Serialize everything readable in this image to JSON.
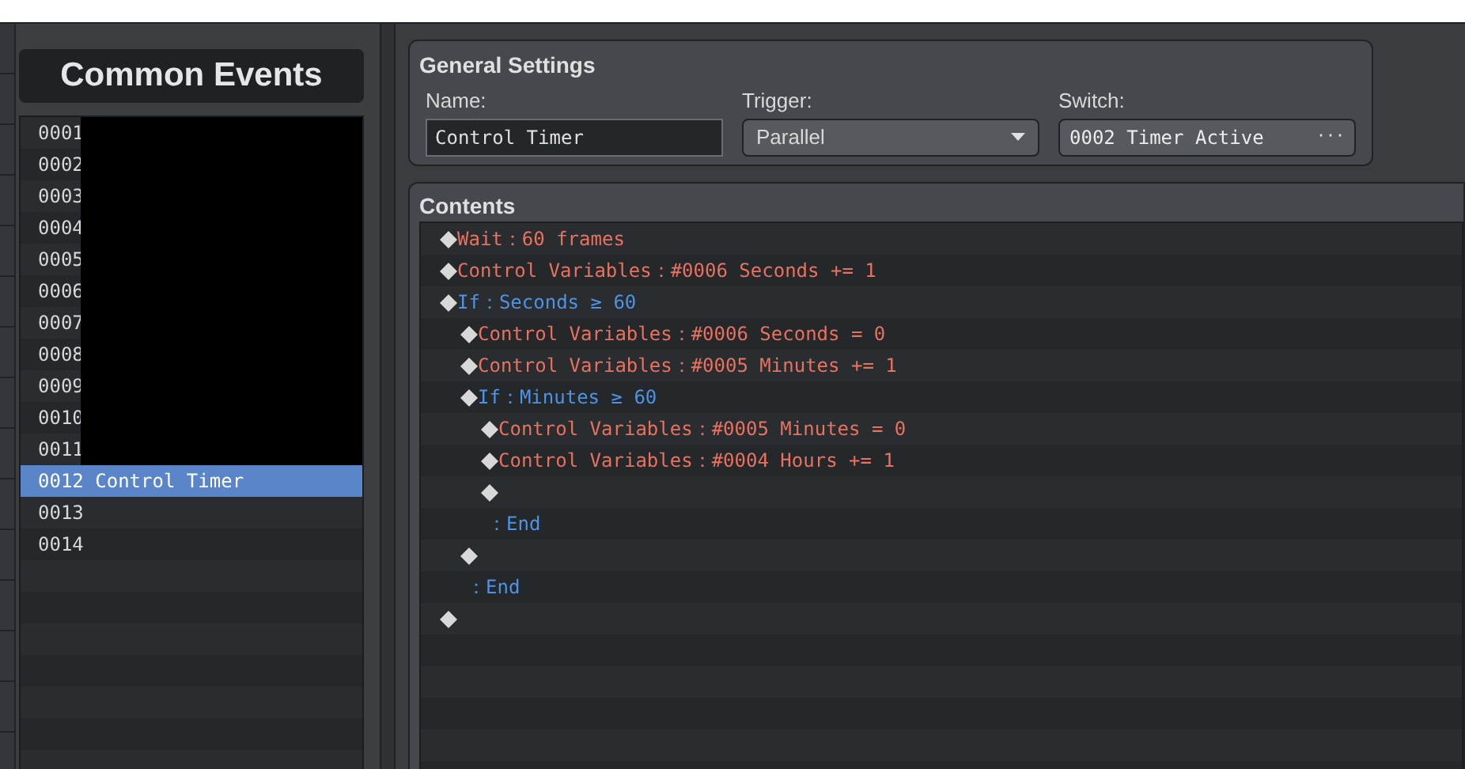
{
  "common_events": {
    "title": "Common Events",
    "items": [
      {
        "number": "0001",
        "redacted": true,
        "selected": false
      },
      {
        "number": "0002",
        "redacted": true,
        "selected": false
      },
      {
        "number": "0003",
        "redacted": true,
        "selected": false
      },
      {
        "number": "0004",
        "redacted": true,
        "selected": false
      },
      {
        "number": "0005",
        "redacted": true,
        "selected": false
      },
      {
        "number": "0006",
        "redacted": true,
        "selected": false
      },
      {
        "number": "0007",
        "redacted": true,
        "selected": false
      },
      {
        "number": "0008",
        "redacted": true,
        "selected": false
      },
      {
        "number": "0009",
        "redacted": true,
        "selected": false
      },
      {
        "number": "0010",
        "redacted": true,
        "selected": false
      },
      {
        "number": "0011",
        "redacted": true,
        "selected": false
      },
      {
        "number": "0012",
        "name": "Control Timer",
        "redacted": false,
        "selected": true
      },
      {
        "number": "0013",
        "redacted": false,
        "selected": false
      },
      {
        "number": "0014",
        "redacted": false,
        "selected": false
      }
    ]
  },
  "general_settings": {
    "title": "General Settings",
    "name": {
      "label": "Name:",
      "value": "Control Timer"
    },
    "trigger": {
      "label": "Trigger:",
      "value": "Parallel"
    },
    "switch": {
      "label": "Switch:",
      "value": "0002 Timer Active",
      "button": "···"
    }
  },
  "contents": {
    "title": "Contents",
    "commands": [
      {
        "kind": "command",
        "text": "Wait：60 frames"
      },
      {
        "kind": "command",
        "text": "Control Variables：#0006 Seconds += 1"
      },
      {
        "kind": "if",
        "text": "If：Seconds ≥ 60",
        "children": [
          {
            "kind": "command",
            "text": "Control Variables：#0006 Seconds = 0"
          },
          {
            "kind": "command",
            "text": "Control Variables：#0005 Minutes += 1"
          },
          {
            "kind": "if",
            "text": "If：Minutes ≥ 60",
            "children": [
              {
                "kind": "command",
                "text": "Control Variables：#0005 Minutes = 0"
              },
              {
                "kind": "command",
                "text": "Control Variables：#0004 Hours += 1"
              },
              {
                "kind": "empty"
              },
              {
                "kind": "end",
                "text": "：End"
              }
            ]
          },
          {
            "kind": "empty"
          },
          {
            "kind": "end",
            "text": "：End"
          }
        ]
      },
      {
        "kind": "empty"
      }
    ]
  }
}
